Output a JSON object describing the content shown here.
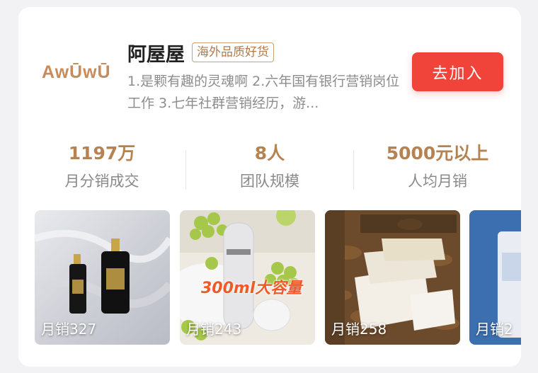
{
  "shop": {
    "logo_text": "AwŪwŪ",
    "name": "阿屋屋",
    "tag": "海外品质好货",
    "description": "1.是颗有趣的灵魂啊 2.六年国有银行营销岗位工作 3.七年社群营销经历，游...",
    "join_label": "去加入"
  },
  "stats": [
    {
      "value": "1197万",
      "label": "月分销成交"
    },
    {
      "value": "8人",
      "label": "团队规模"
    },
    {
      "value": "5000元以上",
      "label": "人均月销"
    }
  ],
  "products": [
    {
      "sales": "月销327"
    },
    {
      "sales": "月销243",
      "overlay": "300ml大容量"
    },
    {
      "sales": "月销258"
    },
    {
      "sales": "月销2"
    }
  ],
  "colors": {
    "accent_red": "#f0433a",
    "brand_gold": "#b58251"
  }
}
